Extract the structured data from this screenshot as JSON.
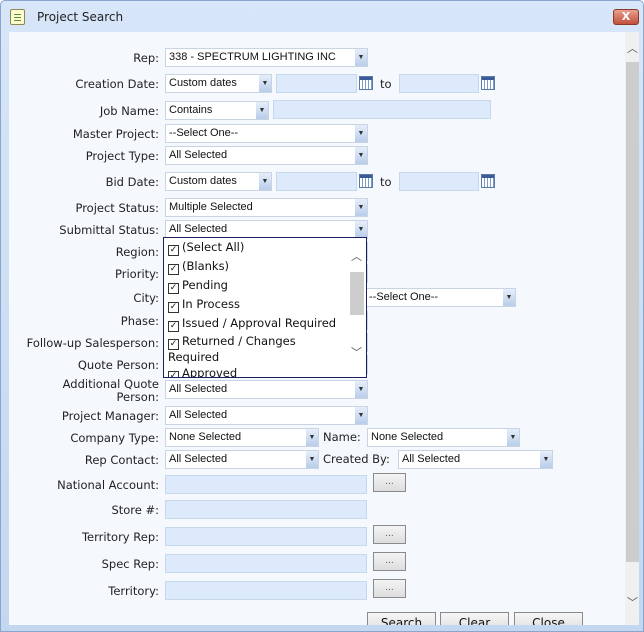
{
  "window": {
    "title": "Project Search",
    "close": "X"
  },
  "form": {
    "rep": {
      "label": "Rep:",
      "value": "338 - SPECTRUM LIGHTING INC"
    },
    "creation_date": {
      "label": "Creation Date:",
      "value": "Custom dates",
      "to": "to",
      "from_value": "",
      "to_value": ""
    },
    "job_name": {
      "label": "Job Name:",
      "value": "Contains",
      "text": ""
    },
    "master_project": {
      "label": "Master Project:",
      "value": "--Select One--"
    },
    "project_type": {
      "label": "Project Type:",
      "value": "All Selected"
    },
    "bid_date": {
      "label": "Bid Date:",
      "value": "Custom dates",
      "to": "to"
    },
    "project_status": {
      "label": "Project Status:",
      "value": "Multiple Selected"
    },
    "submittal_status": {
      "label": "Submittal Status:",
      "value": "All Selected"
    },
    "region": {
      "label": "Region:"
    },
    "priority": {
      "label": "Priority:"
    },
    "city": {
      "label": "City:",
      "value": "--Select One--"
    },
    "phase": {
      "label": "Phase:"
    },
    "followup": {
      "label": "Follow-up Salesperson:"
    },
    "quote_person": {
      "label": "Quote Person:"
    },
    "additional_quote": {
      "label1": "Additional Quote",
      "label2": "Person:",
      "value": "All Selected"
    },
    "project_manager": {
      "label": "Project Manager:",
      "value": "All Selected"
    },
    "company_type": {
      "label": "Company Type:",
      "value": "None Selected"
    },
    "name": {
      "label": "Name:",
      "value": "None Selected"
    },
    "rep_contact": {
      "label": "Rep Contact:",
      "value": "All Selected"
    },
    "created_by": {
      "label": "Created By:",
      "value": "All Selected"
    },
    "national_account": {
      "label": "National Account:",
      "button": "..."
    },
    "store": {
      "label": "Store #:"
    },
    "territory_rep": {
      "label": "Territory Rep:",
      "button": "..."
    },
    "spec_rep": {
      "label": "Spec Rep:",
      "button": "..."
    },
    "territory": {
      "label": "Territory:",
      "button": "..."
    }
  },
  "submittal_dropdown": {
    "items": [
      "(Select All)",
      "(Blanks)",
      "Pending",
      "In Process",
      "Issued / Approval Required",
      "Returned / Changes Required",
      "Approved"
    ],
    "checked": true
  },
  "buttons": {
    "search": "Search",
    "clear": "Clear",
    "close": "Close"
  }
}
